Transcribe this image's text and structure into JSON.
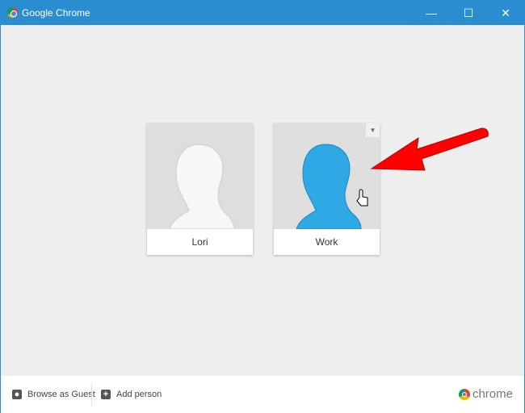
{
  "window": {
    "title": "Google Chrome",
    "minimize": "—",
    "maximize": "☐",
    "close": "✕"
  },
  "profiles": [
    {
      "name": "Lori",
      "color": "#ffffff"
    },
    {
      "name": "Work",
      "color": "#2fa8e6"
    }
  ],
  "footer": {
    "guest_label": "Browse as Guest",
    "add_label": "Add person",
    "add_icon": "+",
    "brand": "chrome"
  },
  "annotation_color": "#ff0000"
}
